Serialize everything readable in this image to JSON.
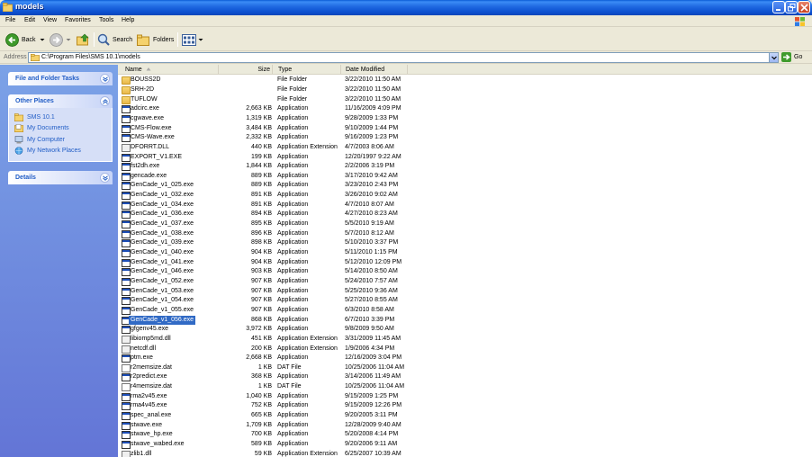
{
  "window": {
    "title": "models"
  },
  "menu": [
    "File",
    "Edit",
    "View",
    "Favorites",
    "Tools",
    "Help"
  ],
  "toolbar": {
    "back": "Back",
    "search": "Search",
    "folders": "Folders"
  },
  "address": {
    "label": "Address",
    "path": "C:\\Program Files\\SMS 10.1\\models",
    "go": "Go"
  },
  "tasks": {
    "file_folder_tasks": "File and Folder Tasks",
    "other_places": "Other Places",
    "places": [
      "SMS 10.1",
      "My Documents",
      "My Computer",
      "My Network Places"
    ],
    "details": "Details"
  },
  "columns": {
    "name": "Name",
    "size": "Size",
    "type": "Type",
    "modified": "Date Modified"
  },
  "files": [
    {
      "name": "BOUSS2D",
      "size": "",
      "type": "File Folder",
      "modified": "3/22/2010 11:50 AM",
      "icon": "folder"
    },
    {
      "name": "SRH-2D",
      "size": "",
      "type": "File Folder",
      "modified": "3/22/2010 11:50 AM",
      "icon": "folder"
    },
    {
      "name": "TUFLOW",
      "size": "",
      "type": "File Folder",
      "modified": "3/22/2010 11:50 AM",
      "icon": "folder"
    },
    {
      "name": "adcirc.exe",
      "size": "2,663 KB",
      "type": "Application",
      "modified": "11/16/2009 4:09 PM",
      "icon": "app"
    },
    {
      "name": "cgwave.exe",
      "size": "1,319 KB",
      "type": "Application",
      "modified": "9/28/2009 1:33 PM",
      "icon": "app"
    },
    {
      "name": "CMS-Flow.exe",
      "size": "3,484 KB",
      "type": "Application",
      "modified": "9/10/2009 1:44 PM",
      "icon": "app"
    },
    {
      "name": "CMS-Wave.exe",
      "size": "2,332 KB",
      "type": "Application",
      "modified": "9/16/2009 1:23 PM",
      "icon": "app"
    },
    {
      "name": "DFORRT.DLL",
      "size": "440 KB",
      "type": "Application Extension",
      "modified": "4/7/2003 8:06 AM",
      "icon": "dll"
    },
    {
      "name": "EXPORT_V1.EXE",
      "size": "199 KB",
      "type": "Application",
      "modified": "12/20/1997 9:22 AM",
      "icon": "app"
    },
    {
      "name": "fst2dh.exe",
      "size": "1,844 KB",
      "type": "Application",
      "modified": "2/2/2006 3:19 PM",
      "icon": "app"
    },
    {
      "name": "gencade.exe",
      "size": "889 KB",
      "type": "Application",
      "modified": "3/17/2010 9:42 AM",
      "icon": "app"
    },
    {
      "name": "GenCade_v1_025.exe",
      "size": "889 KB",
      "type": "Application",
      "modified": "3/23/2010 2:43 PM",
      "icon": "app"
    },
    {
      "name": "GenCade_v1_032.exe",
      "size": "891 KB",
      "type": "Application",
      "modified": "3/26/2010 9:02 AM",
      "icon": "app"
    },
    {
      "name": "GenCade_v1_034.exe",
      "size": "891 KB",
      "type": "Application",
      "modified": "4/7/2010 8:07 AM",
      "icon": "app"
    },
    {
      "name": "GenCade_v1_036.exe",
      "size": "894 KB",
      "type": "Application",
      "modified": "4/27/2010 8:23 AM",
      "icon": "app"
    },
    {
      "name": "GenCade_v1_037.exe",
      "size": "895 KB",
      "type": "Application",
      "modified": "5/5/2010 9:19 AM",
      "icon": "app"
    },
    {
      "name": "GenCade_v1_038.exe",
      "size": "896 KB",
      "type": "Application",
      "modified": "5/7/2010 8:12 AM",
      "icon": "app"
    },
    {
      "name": "GenCade_v1_039.exe",
      "size": "898 KB",
      "type": "Application",
      "modified": "5/10/2010 3:37 PM",
      "icon": "app"
    },
    {
      "name": "GenCade_v1_040.exe",
      "size": "904 KB",
      "type": "Application",
      "modified": "5/11/2010 1:15 PM",
      "icon": "app"
    },
    {
      "name": "GenCade_v1_041.exe",
      "size": "904 KB",
      "type": "Application",
      "modified": "5/12/2010 12:09 PM",
      "icon": "app"
    },
    {
      "name": "GenCade_v1_046.exe",
      "size": "903 KB",
      "type": "Application",
      "modified": "5/14/2010 8:50 AM",
      "icon": "app"
    },
    {
      "name": "GenCade_v1_052.exe",
      "size": "907 KB",
      "type": "Application",
      "modified": "5/24/2010 7:57 AM",
      "icon": "app"
    },
    {
      "name": "GenCade_v1_053.exe",
      "size": "907 KB",
      "type": "Application",
      "modified": "5/25/2010 9:36 AM",
      "icon": "app"
    },
    {
      "name": "GenCade_v1_054.exe",
      "size": "907 KB",
      "type": "Application",
      "modified": "5/27/2010 8:55 AM",
      "icon": "app"
    },
    {
      "name": "GenCade_v1_055.exe",
      "size": "907 KB",
      "type": "Application",
      "modified": "6/3/2010 8:58 AM",
      "icon": "app"
    },
    {
      "name": "GenCade_v1_056.exe",
      "size": "868 KB",
      "type": "Application",
      "modified": "6/7/2010 3:39 PM",
      "icon": "app",
      "selected": true
    },
    {
      "name": "gfgenv45.exe",
      "size": "3,972 KB",
      "type": "Application",
      "modified": "9/8/2009 9:50 AM",
      "icon": "app"
    },
    {
      "name": "libiomp5md.dll",
      "size": "451 KB",
      "type": "Application Extension",
      "modified": "3/31/2009 11:45 AM",
      "icon": "dll"
    },
    {
      "name": "netcdf.dll",
      "size": "200 KB",
      "type": "Application Extension",
      "modified": "1/9/2006 4:34 PM",
      "icon": "dll"
    },
    {
      "name": "ptm.exe",
      "size": "2,668 KB",
      "type": "Application",
      "modified": "12/16/2009 3:04 PM",
      "icon": "app"
    },
    {
      "name": "r2memsize.dat",
      "size": "1 KB",
      "type": "DAT File",
      "modified": "10/25/2006 11:04 AM",
      "icon": "dat"
    },
    {
      "name": "r2predict.exe",
      "size": "368 KB",
      "type": "Application",
      "modified": "3/14/2006 11:49 AM",
      "icon": "app"
    },
    {
      "name": "r4memsize.dat",
      "size": "1 KB",
      "type": "DAT File",
      "modified": "10/25/2006 11:04 AM",
      "icon": "dat"
    },
    {
      "name": "rma2v45.exe",
      "size": "1,040 KB",
      "type": "Application",
      "modified": "9/15/2009 1:25 PM",
      "icon": "app"
    },
    {
      "name": "rma4v45.exe",
      "size": "752 KB",
      "type": "Application",
      "modified": "9/15/2009 12:26 PM",
      "icon": "app"
    },
    {
      "name": "spec_anal.exe",
      "size": "665 KB",
      "type": "Application",
      "modified": "9/20/2005 3:11 PM",
      "icon": "app"
    },
    {
      "name": "stwave.exe",
      "size": "1,709 KB",
      "type": "Application",
      "modified": "12/28/2009 9:40 AM",
      "icon": "app"
    },
    {
      "name": "stwave_hp.exe",
      "size": "700 KB",
      "type": "Application",
      "modified": "5/20/2008 4:14 PM",
      "icon": "app"
    },
    {
      "name": "stwave_wabed.exe",
      "size": "589 KB",
      "type": "Application",
      "modified": "9/20/2006 9:11 AM",
      "icon": "app"
    },
    {
      "name": "zlib1.dll",
      "size": "59 KB",
      "type": "Application Extension",
      "modified": "6/25/2007 10:39 AM",
      "icon": "dll"
    }
  ]
}
